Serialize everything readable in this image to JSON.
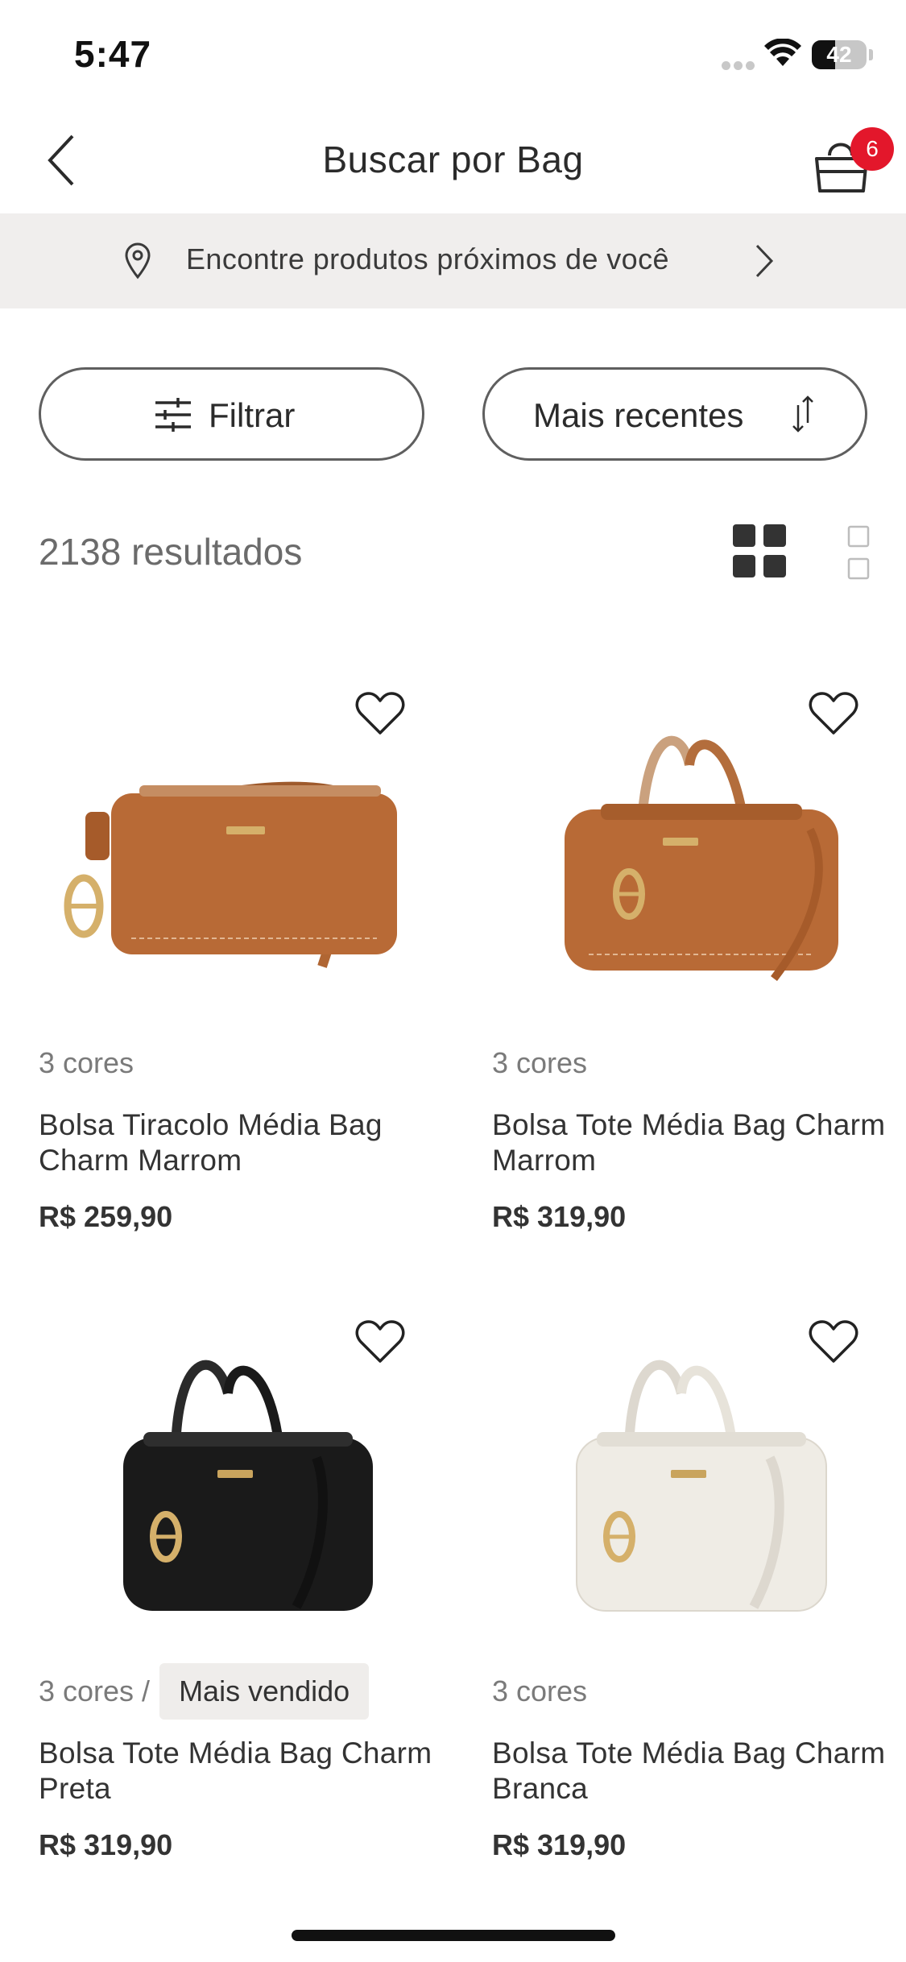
{
  "status_bar": {
    "time": "5:47",
    "battery": "42",
    "battery_level": 0.42
  },
  "header": {
    "title": "Buscar por Bag",
    "back_icon": "chevron-left-icon",
    "cart_icon": "shopping-bag-icon",
    "cart_count": "6"
  },
  "location_banner": {
    "text": "Encontre produtos próximos de você",
    "icon": "location-pin-icon",
    "chevron": "chevron-right-icon"
  },
  "controls": {
    "filter_label": "Filtrar",
    "sort_label": "Mais recentes",
    "results_count": "2138 resultados"
  },
  "colors": {
    "badge_red": "#e3172b",
    "banner_bg": "#f0eeed",
    "bag_brown": "#b86a36",
    "bag_black": "#1a1a1a",
    "bag_white": "#efece5",
    "gold": "#d5b06a"
  },
  "products": [
    {
      "colors_label": "3 cores",
      "badge": "",
      "name": "Bolsa Tiracolo Média Bag Charm Marrom",
      "price": "R$ 259,90"
    },
    {
      "colors_label": "3 cores",
      "badge": "",
      "name": "Bolsa Tote Média Bag Charm Marrom",
      "price": "R$ 319,90"
    },
    {
      "colors_label": "3 cores /",
      "badge": "Mais vendido",
      "name": "Bolsa Tote Média Bag Charm Preta",
      "price": "R$ 319,90"
    },
    {
      "colors_label": "3 cores",
      "badge": "",
      "name": "Bolsa Tote Média Bag Charm Branca",
      "price": "R$ 319,90"
    }
  ]
}
